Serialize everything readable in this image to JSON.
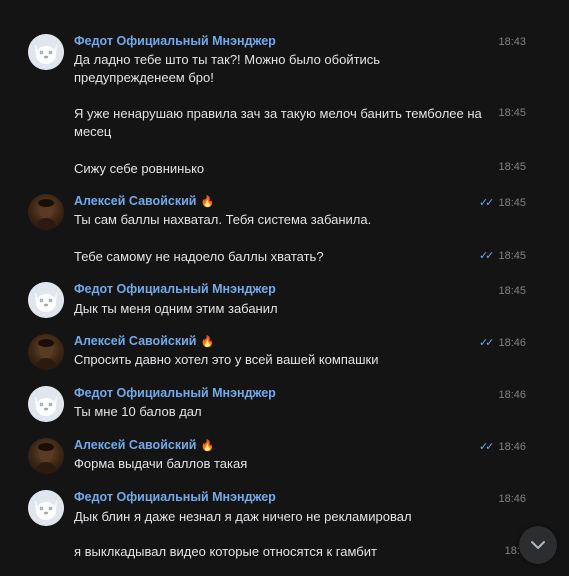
{
  "bot_name": "Федот Официальный Мнэнджер",
  "user_name": "Алексей Савойский",
  "user_badge": "🔥",
  "messages": {
    "g1": {
      "time": "18:43",
      "text": "Да ладно тебе што ты так?! Можно было обойтись предупрежденеем бро!"
    },
    "g1b": {
      "time": "18:45",
      "text": "Я уже ненарушаю правила зач за такую мелоч банить темболее на месец"
    },
    "g1c": {
      "time": "18:45",
      "text": "Сижу себе ровнинько"
    },
    "g2": {
      "time": "18:45",
      "text": "Ты сам баллы нахватал. Тебя система забанила."
    },
    "g2b": {
      "time": "18:45",
      "text": "Тебе самому не надоело баллы хватать?"
    },
    "g3": {
      "time": "18:45",
      "text": "Дык ты меня одним этим забанил"
    },
    "g4": {
      "time": "18:46",
      "text": "Спросить давно хотел это у всей вашей компашки"
    },
    "g5": {
      "time": "18:46",
      "text": "Ты мне 10 балов дал"
    },
    "g6": {
      "time": "18:46",
      "text": "Форма выдачи баллов такая"
    },
    "g7": {
      "time": "18:46",
      "text": "Дык блин я даже незнал я даж ничего не рекламировал"
    },
    "g7b": {
      "time": "18:4",
      "text": "я выклкадывал видео которые относятся к гамбит"
    }
  },
  "read_mark": "✓✓",
  "colors": {
    "background": "#141414",
    "author": "#71aaeb",
    "text": "#e1e3e6",
    "time": "#828282"
  },
  "icons": {
    "scroll": "chevron-down-icon",
    "bot_avatar": "dog-avatar-icon"
  }
}
